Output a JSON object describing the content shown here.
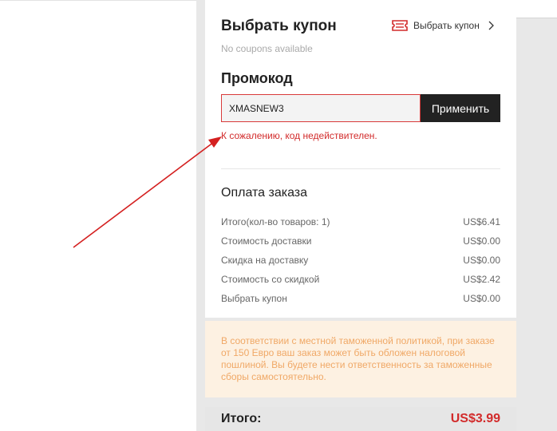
{
  "coupon": {
    "title": "Выбрать купон",
    "no_coupons": "No coupons available",
    "select_label": "Выбрать купон",
    "icon": "coupon-ticket-icon"
  },
  "promo": {
    "title": "Промокод",
    "value": "XMASNEW3",
    "apply_label": "Применить",
    "error": "К сожалению, код недействителен."
  },
  "summary": {
    "title": "Оплата заказа",
    "rows": [
      {
        "label": "Итого(кол-во товаров: 1)",
        "value": "US$6.41"
      },
      {
        "label": "Стоимость доставки",
        "value": "US$0.00"
      },
      {
        "label": "Скидка на доставку",
        "value": "US$0.00"
      },
      {
        "label": "Стоимость со скидкой",
        "value": "US$2.42"
      },
      {
        "label": "Выбрать купон",
        "value": "US$0.00"
      }
    ]
  },
  "notice": "В соответствии с местной таможенной политикой, при заказе от 150 Евро ваш заказ может быть обложен налоговой пошлиной. Вы будете нести ответственность за таможенные сборы самостоятельно.",
  "total": {
    "label": "Итого:",
    "value": "US$3.99"
  },
  "colors": {
    "accent": "#d22b2b",
    "button": "#222222",
    "notice_bg": "#fdf1e2",
    "notice_text": "#f0a866",
    "annotation_arrow": "#d42020"
  }
}
